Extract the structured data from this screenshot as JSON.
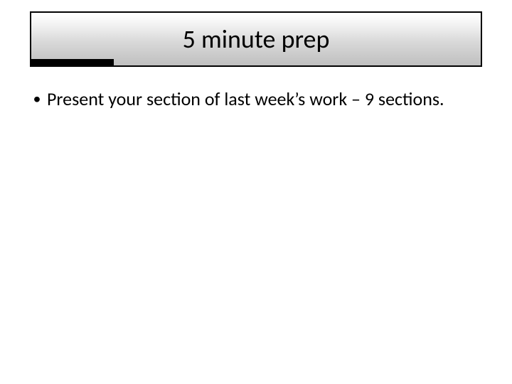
{
  "slide": {
    "title": "5 minute prep",
    "bullets": [
      {
        "text": "Present your section of last week’s work – 9 sections."
      }
    ],
    "bullet_marker": "•"
  }
}
